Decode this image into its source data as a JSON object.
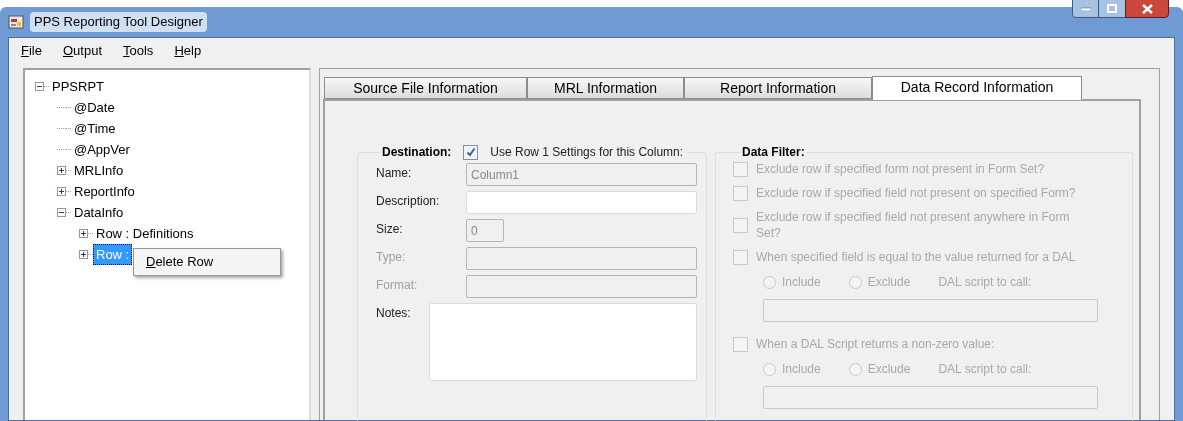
{
  "window": {
    "title": "PPS Reporting Tool Designer"
  },
  "menu": [
    {
      "key": "F",
      "rest": "ile"
    },
    {
      "key": "O",
      "rest": "utput"
    },
    {
      "key": "T",
      "rest": "ools"
    },
    {
      "key": "H",
      "rest": "elp"
    }
  ],
  "tree": [
    {
      "label": "PPSRPT",
      "expanded": true,
      "selected": false,
      "children": [
        {
          "label": "@Date",
          "selected": false
        },
        {
          "label": "@Time",
          "selected": false
        },
        {
          "label": "@AppVer",
          "selected": false
        },
        {
          "label": "MRLInfo",
          "expanded": false,
          "selected": false
        },
        {
          "label": "ReportInfo",
          "expanded": false,
          "selected": false
        },
        {
          "label": "DataInfo",
          "expanded": true,
          "selected": false,
          "children": [
            {
              "label": "Row : Definitions",
              "expanded": false,
              "selected": false
            },
            {
              "label": "Row :",
              "expanded": false,
              "selected": true
            }
          ]
        }
      ]
    }
  ],
  "context_menu": {
    "items": [
      {
        "key": "D",
        "rest": "elete Row"
      }
    ]
  },
  "tabs": [
    {
      "label": "Source File Information",
      "selected": false
    },
    {
      "label": "MRL Information",
      "selected": false
    },
    {
      "label": "Report Information",
      "selected": false
    },
    {
      "label": "Data Record Information",
      "selected": true
    }
  ],
  "destination": {
    "title": "Destination:",
    "use_row1": {
      "label": "Use Row 1 Settings for this Column:",
      "checked": true
    },
    "fields": [
      {
        "label": "Name:",
        "value": "Column1",
        "readonly": true,
        "disabled": false,
        "kind": "text"
      },
      {
        "label": "Description:",
        "readonly": false,
        "disabled": false,
        "kind": "text"
      },
      {
        "label": "Size:",
        "value": "0",
        "readonly": true,
        "disabled": false,
        "kind": "short"
      },
      {
        "label": "Type:",
        "disabled": true,
        "kind": "text"
      },
      {
        "label": "Format:",
        "disabled": true,
        "kind": "text"
      },
      {
        "label": "Notes:",
        "readonly": false,
        "disabled": false,
        "kind": "multiline"
      }
    ]
  },
  "data_filter": {
    "title": "Data Filter:",
    "disabled": true,
    "items": [
      {
        "kind": "checkbox",
        "label": "Exclude row if specified form not present in Form Set?",
        "checked": false
      },
      {
        "kind": "checkbox",
        "label": "Exclude row if specified field not present on specified Form?",
        "checked": false
      },
      {
        "kind": "checkbox",
        "label": "Exclude row if specified field not present anywhere in Form Set?",
        "checked": false
      },
      {
        "kind": "checkbox",
        "label": "When specified field is equal to the value returned for a DAL",
        "checked": false
      },
      {
        "kind": "radio_group",
        "options": [
          {
            "label": "Include",
            "selected": false
          },
          {
            "label": "Exclude",
            "selected": false
          }
        ],
        "script_label": "DAL script to call:"
      },
      {
        "kind": "checkbox",
        "label": "When a DAL Script returns a non-zero value:",
        "checked": false
      },
      {
        "kind": "radio_group",
        "options": [
          {
            "label": "Include",
            "selected": false
          },
          {
            "label": "Exclude",
            "selected": false
          }
        ],
        "script_label": "DAL script to call:"
      }
    ]
  }
}
